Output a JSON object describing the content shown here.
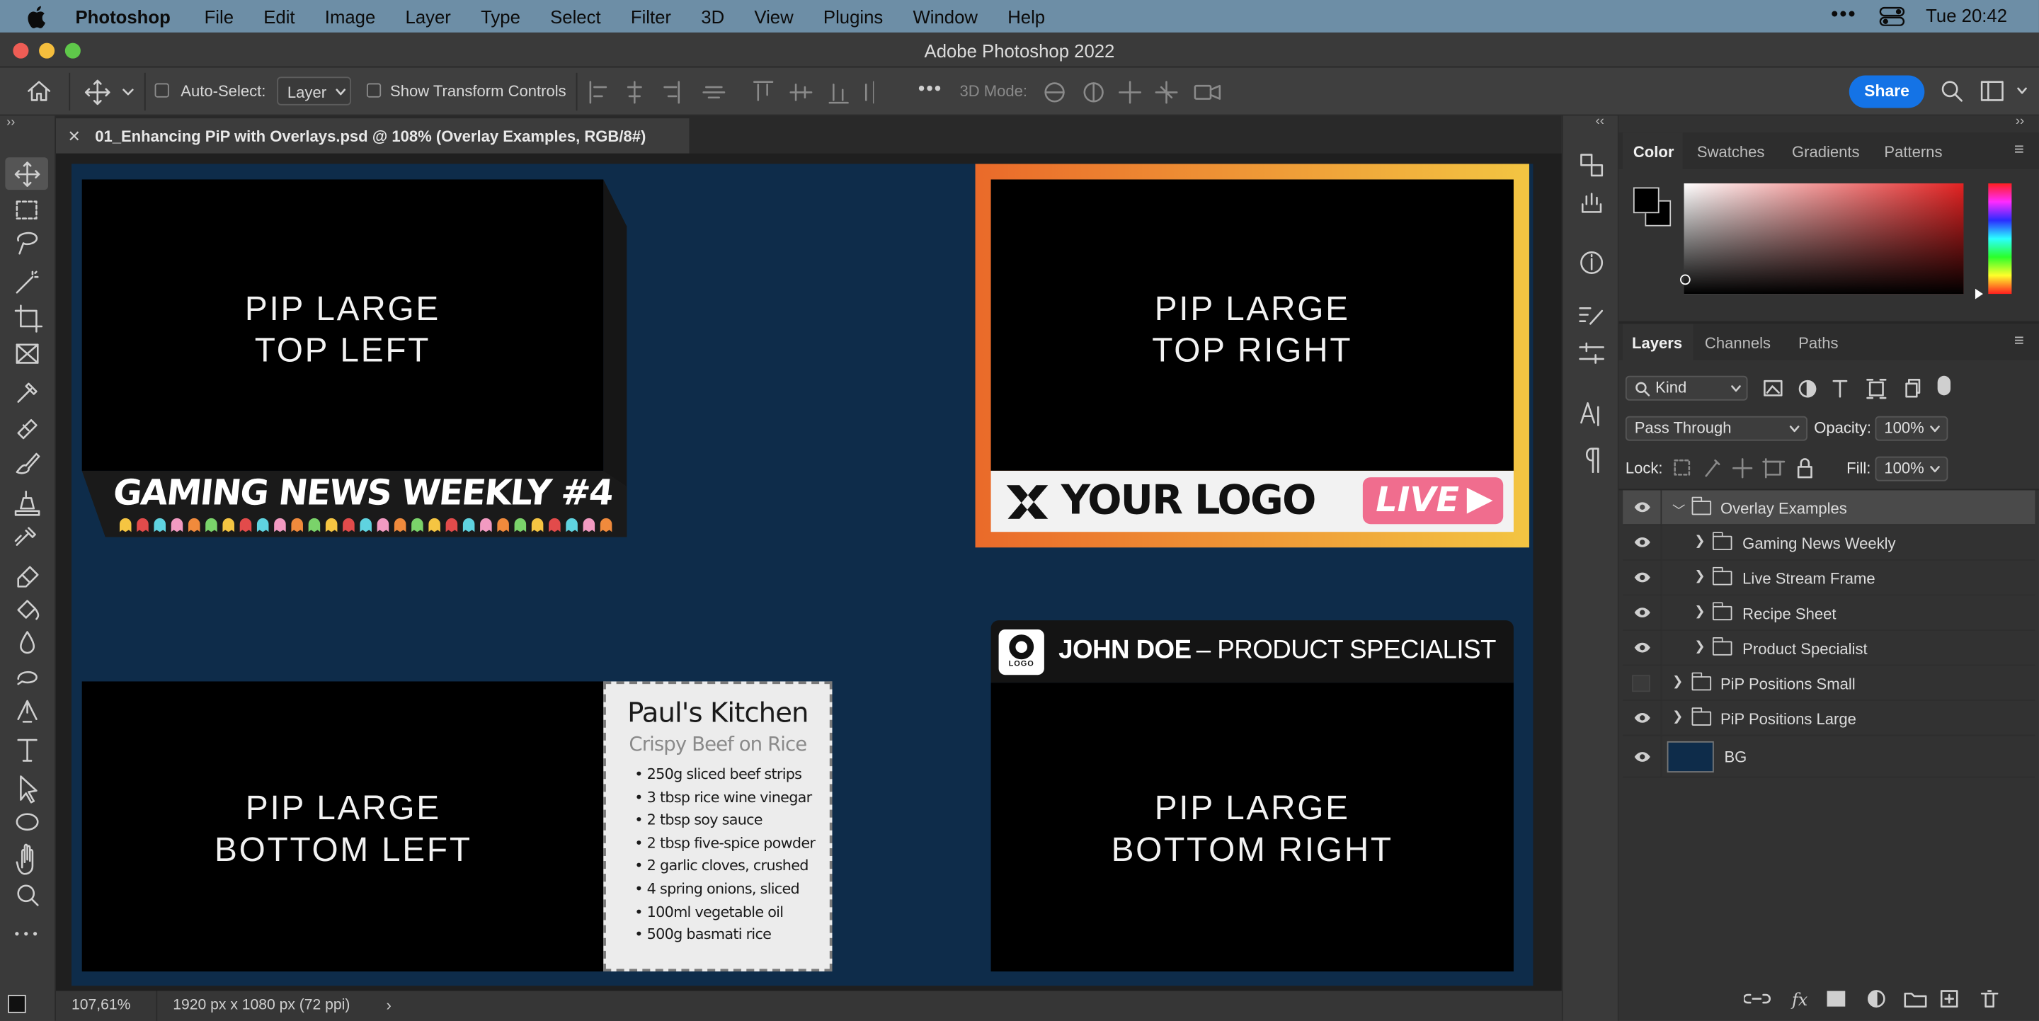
{
  "menubar": {
    "app": "Photoshop",
    "items": [
      "File",
      "Edit",
      "Image",
      "Layer",
      "Type",
      "Select",
      "Filter",
      "3D",
      "View",
      "Plugins",
      "Window",
      "Help"
    ],
    "clock": "Tue 20:42"
  },
  "window": {
    "title": "Adobe Photoshop 2022"
  },
  "options": {
    "auto_select_label": "Auto-Select:",
    "auto_select_value": "Layer",
    "show_transform_label": "Show Transform Controls",
    "mode3d_label": "3D Mode:",
    "share_label": "Share"
  },
  "document": {
    "tab_title": "01_Enhancing PiP with Overlays.psd @ 108% (Overlay Examples, RGB/8#)"
  },
  "canvas": {
    "pip_top_left": [
      "PIP LARGE",
      "TOP LEFT"
    ],
    "pip_top_right": [
      "PIP LARGE",
      "TOP RIGHT"
    ],
    "pip_bottom_left": [
      "PIP LARGE",
      "BOTTOM LEFT"
    ],
    "pip_bottom_right": [
      "PIP LARGE",
      "BOTTOM RIGHT"
    ],
    "gaming_title": "GAMING NEWS WEEKLY #4",
    "logo_text": "YOUR LOGO",
    "live_text": "LIVE",
    "recipe": {
      "title": "Paul's Kitchen",
      "subtitle": "Crispy Beef on Rice",
      "items": [
        "• 250g sliced beef strips",
        "• 3 tbsp rice wine vinegar",
        "• 2 tbsp soy sauce",
        "• 2 tbsp five-spice powder",
        "• 2 garlic cloves, crushed",
        "• 4 spring onions, sliced",
        "• 100ml vegetable oil",
        "• 500g basmati rice"
      ]
    },
    "lower_third": {
      "logo": "LOGO",
      "name": "JOHN DOE",
      "role": "– PRODUCT SPECIALIST"
    },
    "colors": {
      "bg": "#0e2c4a",
      "frame_start": "#ea6a2a",
      "frame_end": "#f3c542",
      "live_pill": "#f06d8e"
    }
  },
  "status": {
    "zoom": "107,61%",
    "doc_size": "1920 px x 1080 px (72 ppi)"
  },
  "color_panel": {
    "tabs": [
      "Color",
      "Swatches",
      "Gradients",
      "Patterns"
    ]
  },
  "layers_panel": {
    "tabs": [
      "Layers",
      "Channels",
      "Paths"
    ],
    "filter_kind": "Kind",
    "blend_mode": "Pass Through",
    "opacity_label": "Opacity:",
    "opacity_value": "100%",
    "lock_label": "Lock:",
    "fill_label": "Fill:",
    "fill_value": "100%",
    "layers": [
      {
        "name": "Overlay Examples",
        "visible": true,
        "indent": 0,
        "expanded": true,
        "selected": true
      },
      {
        "name": "Gaming News Weekly",
        "visible": true,
        "indent": 1
      },
      {
        "name": "Live Stream Frame",
        "visible": true,
        "indent": 1
      },
      {
        "name": "Recipe Sheet",
        "visible": true,
        "indent": 1
      },
      {
        "name": "Product Specialist",
        "visible": true,
        "indent": 1
      },
      {
        "name": "PiP Positions Small",
        "visible": false,
        "indent": 0
      },
      {
        "name": "PiP Positions Large",
        "visible": true,
        "indent": 0
      },
      {
        "name": "BG",
        "visible": true,
        "indent": 0,
        "thumb": "#0e2c4a"
      }
    ]
  }
}
